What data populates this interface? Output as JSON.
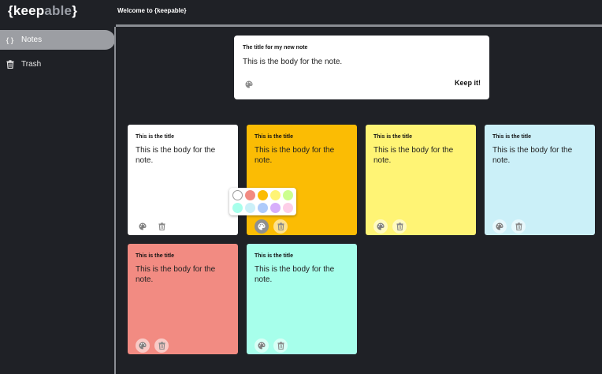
{
  "header": {
    "logo_brace_open": "{",
    "logo_keep": "keep",
    "logo_able": "able",
    "logo_brace_close": "}",
    "welcome": "Welcome to {keepable}"
  },
  "sidebar": {
    "items": [
      {
        "label": "Notes",
        "icon": "braces-icon",
        "icon_glyph": "{ }",
        "active": true
      },
      {
        "label": "Trash",
        "icon": "trash-icon",
        "active": false
      }
    ]
  },
  "compose": {
    "title": "The title for my new note",
    "body": "This is the body for the note.",
    "keep_label": "Keep it!"
  },
  "notes": [
    {
      "title": "This is the title",
      "body": "This is the body for the note.",
      "color": "#ffffff"
    },
    {
      "title": "This is the title",
      "body": "This is the body for the note.",
      "color": "#fbbc04"
    },
    {
      "title": "This is the title",
      "body": "This is the body for the note.",
      "color": "#fff475"
    },
    {
      "title": "This is the title",
      "body": "This is the body for the note.",
      "color": "#cbf0f8"
    },
    {
      "title": "This is the title",
      "body": "This is the body for the note.",
      "color": "#f28b82"
    },
    {
      "title": "This is the title",
      "body": "This is the body for the note.",
      "color": "#a7ffeb"
    }
  ],
  "color_picker": {
    "colors": [
      "#ffffff",
      "#f28b82",
      "#fbbc04",
      "#fff475",
      "#ccff90",
      "#a7ffeb",
      "#cbf0f8",
      "#aecbfa",
      "#d7aefb",
      "#fdcfe8"
    ]
  }
}
